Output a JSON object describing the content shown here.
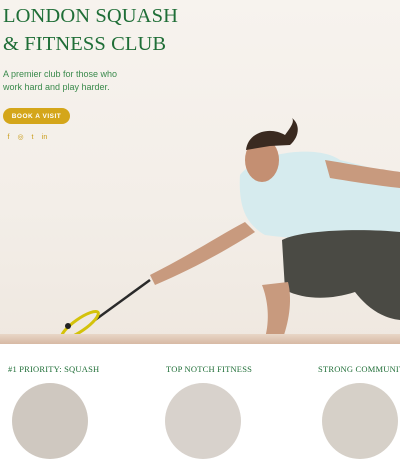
{
  "hero": {
    "title_line1": "LONDON SQUASH",
    "title_line2": "& FITNESS CLUB",
    "subtitle": "A premier club for those who work hard and play harder.",
    "cta_label": "BOOK A VISIT"
  },
  "social": {
    "facebook": "f",
    "instagram": "◎",
    "twitter": "t",
    "linkedin": "in"
  },
  "features": [
    {
      "title": "#1 PRIORITY: SQUASH"
    },
    {
      "title": "TOP NOTCH FITNESS"
    },
    {
      "title": "STRONG COMMUNITY"
    }
  ],
  "colors": {
    "brand_green": "#1f6e37",
    "accent_gold": "#d4a61a"
  }
}
